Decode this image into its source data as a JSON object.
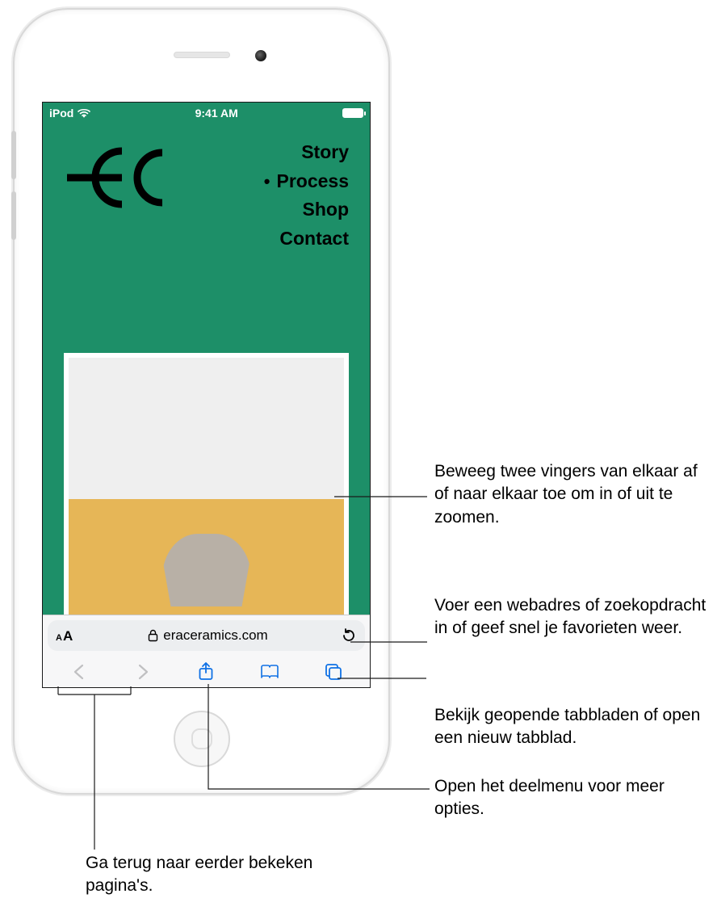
{
  "statusbar": {
    "carrier": "iPod",
    "time": "9:41 AM"
  },
  "webpage": {
    "nav": [
      {
        "label": "Story",
        "active": false
      },
      {
        "label": "Process",
        "active": true
      },
      {
        "label": "Shop",
        "active": false
      },
      {
        "label": "Contact",
        "active": false
      }
    ]
  },
  "addressbar": {
    "url": "eraceramics.com"
  },
  "callouts": {
    "zoom": "Beweeg twee vingers van elkaar af of naar elkaar toe om in of uit te zoomen.",
    "address": "Voer een webadres of zoekopdracht in of geef snel je favorieten weer.",
    "tabs": "Bekijk geopende tabbladen of open een nieuw tabblad.",
    "share": "Open het deelmenu voor meer opties.",
    "back": "Ga terug naar eerder bekeken pagina's."
  }
}
